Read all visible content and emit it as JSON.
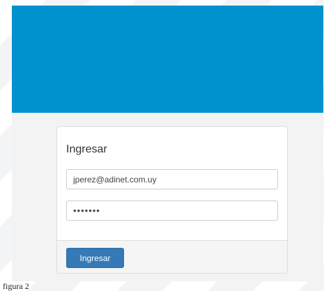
{
  "login": {
    "title": "Ingresar",
    "email_value": "jperez@adinet.com.uy",
    "password_value": "1234567",
    "submit_label": "Ingresar"
  },
  "caption": "figura 2",
  "colors": {
    "header": "#0091cf",
    "button": "#337ab7"
  }
}
